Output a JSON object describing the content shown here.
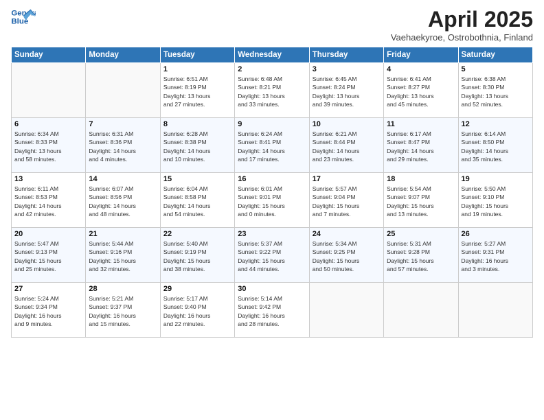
{
  "header": {
    "logo_line1": "General",
    "logo_line2": "Blue",
    "title": "April 2025",
    "subtitle": "Vaehaekyroe, Ostrobothnia, Finland"
  },
  "weekdays": [
    "Sunday",
    "Monday",
    "Tuesday",
    "Wednesday",
    "Thursday",
    "Friday",
    "Saturday"
  ],
  "weeks": [
    [
      {
        "day": "",
        "info": ""
      },
      {
        "day": "",
        "info": ""
      },
      {
        "day": "1",
        "info": "Sunrise: 6:51 AM\nSunset: 8:19 PM\nDaylight: 13 hours\nand 27 minutes."
      },
      {
        "day": "2",
        "info": "Sunrise: 6:48 AM\nSunset: 8:21 PM\nDaylight: 13 hours\nand 33 minutes."
      },
      {
        "day": "3",
        "info": "Sunrise: 6:45 AM\nSunset: 8:24 PM\nDaylight: 13 hours\nand 39 minutes."
      },
      {
        "day": "4",
        "info": "Sunrise: 6:41 AM\nSunset: 8:27 PM\nDaylight: 13 hours\nand 45 minutes."
      },
      {
        "day": "5",
        "info": "Sunrise: 6:38 AM\nSunset: 8:30 PM\nDaylight: 13 hours\nand 52 minutes."
      }
    ],
    [
      {
        "day": "6",
        "info": "Sunrise: 6:34 AM\nSunset: 8:33 PM\nDaylight: 13 hours\nand 58 minutes."
      },
      {
        "day": "7",
        "info": "Sunrise: 6:31 AM\nSunset: 8:36 PM\nDaylight: 14 hours\nand 4 minutes."
      },
      {
        "day": "8",
        "info": "Sunrise: 6:28 AM\nSunset: 8:38 PM\nDaylight: 14 hours\nand 10 minutes."
      },
      {
        "day": "9",
        "info": "Sunrise: 6:24 AM\nSunset: 8:41 PM\nDaylight: 14 hours\nand 17 minutes."
      },
      {
        "day": "10",
        "info": "Sunrise: 6:21 AM\nSunset: 8:44 PM\nDaylight: 14 hours\nand 23 minutes."
      },
      {
        "day": "11",
        "info": "Sunrise: 6:17 AM\nSunset: 8:47 PM\nDaylight: 14 hours\nand 29 minutes."
      },
      {
        "day": "12",
        "info": "Sunrise: 6:14 AM\nSunset: 8:50 PM\nDaylight: 14 hours\nand 35 minutes."
      }
    ],
    [
      {
        "day": "13",
        "info": "Sunrise: 6:11 AM\nSunset: 8:53 PM\nDaylight: 14 hours\nand 42 minutes."
      },
      {
        "day": "14",
        "info": "Sunrise: 6:07 AM\nSunset: 8:56 PM\nDaylight: 14 hours\nand 48 minutes."
      },
      {
        "day": "15",
        "info": "Sunrise: 6:04 AM\nSunset: 8:58 PM\nDaylight: 14 hours\nand 54 minutes."
      },
      {
        "day": "16",
        "info": "Sunrise: 6:01 AM\nSunset: 9:01 PM\nDaylight: 15 hours\nand 0 minutes."
      },
      {
        "day": "17",
        "info": "Sunrise: 5:57 AM\nSunset: 9:04 PM\nDaylight: 15 hours\nand 7 minutes."
      },
      {
        "day": "18",
        "info": "Sunrise: 5:54 AM\nSunset: 9:07 PM\nDaylight: 15 hours\nand 13 minutes."
      },
      {
        "day": "19",
        "info": "Sunrise: 5:50 AM\nSunset: 9:10 PM\nDaylight: 15 hours\nand 19 minutes."
      }
    ],
    [
      {
        "day": "20",
        "info": "Sunrise: 5:47 AM\nSunset: 9:13 PM\nDaylight: 15 hours\nand 25 minutes."
      },
      {
        "day": "21",
        "info": "Sunrise: 5:44 AM\nSunset: 9:16 PM\nDaylight: 15 hours\nand 32 minutes."
      },
      {
        "day": "22",
        "info": "Sunrise: 5:40 AM\nSunset: 9:19 PM\nDaylight: 15 hours\nand 38 minutes."
      },
      {
        "day": "23",
        "info": "Sunrise: 5:37 AM\nSunset: 9:22 PM\nDaylight: 15 hours\nand 44 minutes."
      },
      {
        "day": "24",
        "info": "Sunrise: 5:34 AM\nSunset: 9:25 PM\nDaylight: 15 hours\nand 50 minutes."
      },
      {
        "day": "25",
        "info": "Sunrise: 5:31 AM\nSunset: 9:28 PM\nDaylight: 15 hours\nand 57 minutes."
      },
      {
        "day": "26",
        "info": "Sunrise: 5:27 AM\nSunset: 9:31 PM\nDaylight: 16 hours\nand 3 minutes."
      }
    ],
    [
      {
        "day": "27",
        "info": "Sunrise: 5:24 AM\nSunset: 9:34 PM\nDaylight: 16 hours\nand 9 minutes."
      },
      {
        "day": "28",
        "info": "Sunrise: 5:21 AM\nSunset: 9:37 PM\nDaylight: 16 hours\nand 15 minutes."
      },
      {
        "day": "29",
        "info": "Sunrise: 5:17 AM\nSunset: 9:40 PM\nDaylight: 16 hours\nand 22 minutes."
      },
      {
        "day": "30",
        "info": "Sunrise: 5:14 AM\nSunset: 9:42 PM\nDaylight: 16 hours\nand 28 minutes."
      },
      {
        "day": "",
        "info": ""
      },
      {
        "day": "",
        "info": ""
      },
      {
        "day": "",
        "info": ""
      }
    ]
  ]
}
